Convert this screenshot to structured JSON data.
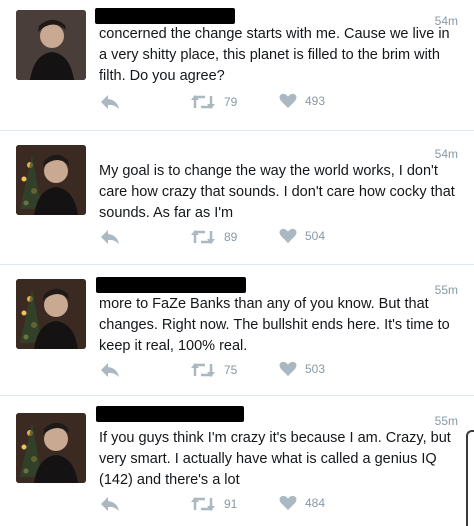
{
  "tweets": [
    {
      "time": "54m",
      "text": "concerned the change starts with me. Cause we live in a very shitty place, this planet is filled to the brim with filth. Do you agree?",
      "retweets": "79",
      "likes": "493"
    },
    {
      "time": "54m",
      "text": "My goal is to change the way the world works, I don't care how crazy that sounds. I don't care how cocky that sounds. As far as I'm",
      "retweets": "89",
      "likes": "504"
    },
    {
      "time": "55m",
      "text": "more to FaZe Banks than any of you know. But that changes. Right now. The bullshit ends here. It's time to keep it real, 100% real.",
      "retweets": "75",
      "likes": "503"
    },
    {
      "time": "55m",
      "text": "If you guys think I'm crazy it's because I am. Crazy, but very smart. I actually have what is called a genius IQ (142) and there's a lot",
      "retweets": "91",
      "likes": "484"
    }
  ],
  "colors": {
    "icon": "#aab8c2",
    "meta": "#8899a6",
    "divider": "#e1e8ed",
    "text": "#14171a"
  },
  "icons": {
    "reply": "reply-icon",
    "retweet": "retweet-icon",
    "like": "heart-icon"
  }
}
